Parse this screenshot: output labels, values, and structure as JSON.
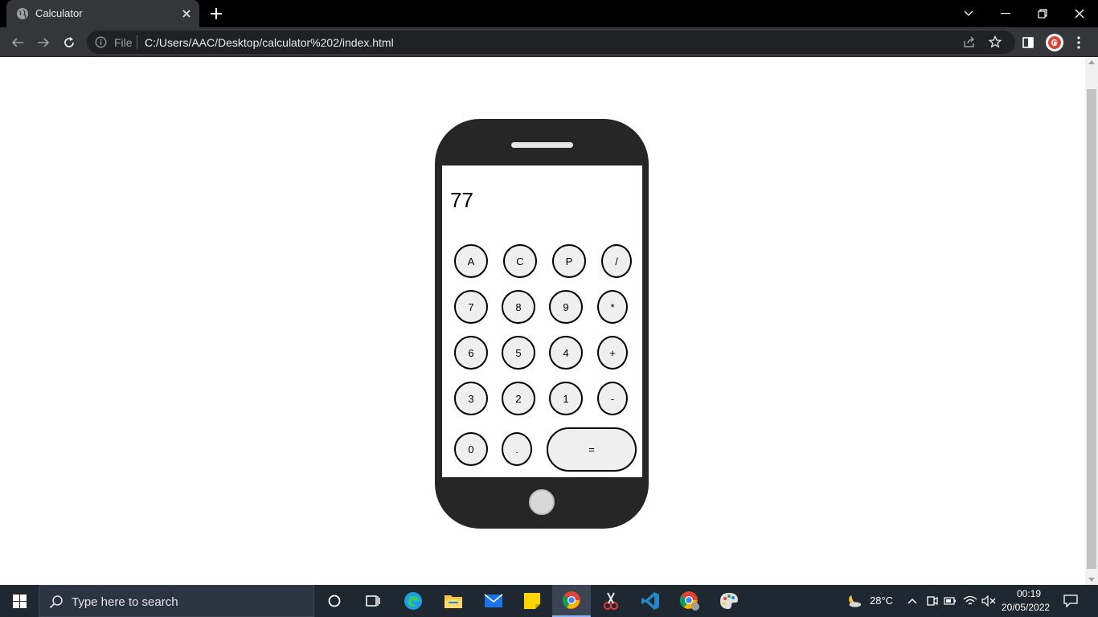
{
  "browser": {
    "tab_title": "Calculator",
    "scheme_label": "File",
    "url": "C:/Users/AAC/Desktop/calculator%202/index.html"
  },
  "calculator": {
    "display": "77",
    "rows": [
      [
        "A",
        "C",
        "P",
        "/"
      ],
      [
        "7",
        "8",
        "9",
        "*"
      ],
      [
        "6",
        "5",
        "4",
        "+"
      ],
      [
        "3",
        "2",
        "1",
        "-"
      ],
      [
        "0",
        ".",
        "="
      ]
    ]
  },
  "taskbar": {
    "search_placeholder": "Type here to search",
    "temperature": "28°C",
    "time": "00:19",
    "date": "20/05/2022"
  },
  "colors": {
    "chrome_dark": "#35363a",
    "phone_body": "#262626",
    "taskbar": "#1f2730",
    "key_fill": "#efefef"
  }
}
